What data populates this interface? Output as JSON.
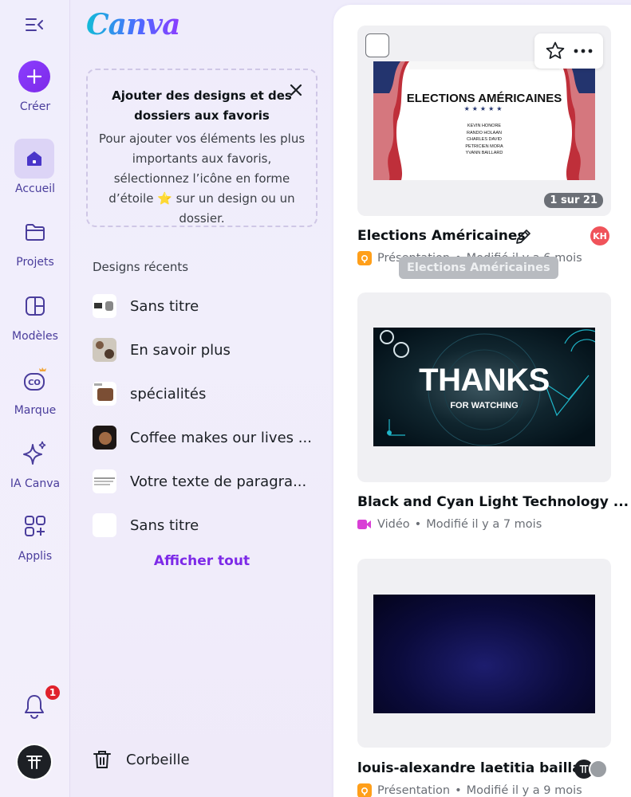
{
  "rail": {
    "create_label": "Créer",
    "items": [
      {
        "label": "Accueil",
        "icon": "home-icon"
      },
      {
        "label": "Projets",
        "icon": "folder-icon"
      },
      {
        "label": "Modèles",
        "icon": "templates-icon"
      },
      {
        "label": "Marque",
        "icon": "brand-icon"
      },
      {
        "label": "IA Canva",
        "icon": "sparkle-icon"
      },
      {
        "label": "Applis",
        "icon": "apps-icon"
      }
    ],
    "notification_count": "1",
    "user_initials": "TT"
  },
  "logo": "Canva",
  "favorites_card": {
    "title": "Ajouter des designs et des dossiers aux favoris",
    "description": "Pour ajouter vos éléments les plus importants aux favoris, sélectionnez l’icône en forme d’étoile ⭐ sur un design ou un dossier."
  },
  "recent": {
    "title": "Designs récents",
    "items": [
      {
        "label": "Sans titre"
      },
      {
        "label": "En savoir plus"
      },
      {
        "label": "spécialités"
      },
      {
        "label": "Coffee makes our lives ..."
      },
      {
        "label": "Votre texte de paragra..."
      },
      {
        "label": "Sans titre"
      }
    ],
    "show_all": "Afficher tout"
  },
  "trash_label": "Corbeille",
  "designs": [
    {
      "title": "Elections Américaines",
      "type": "Présentation",
      "modified": "Modifié il y a 6 mois",
      "pages": "1 sur 21",
      "tooltip": "Elections Américaines",
      "avatar": "KH",
      "thumb_heading": "ELECTIONS AMÉRICAINES",
      "thumb_names": [
        "KEVIN HONORE",
        "RANDO HOLAAN",
        "CHARLES DAVID",
        "PETRICIEN MORA",
        "YVANN BAILLARD"
      ]
    },
    {
      "title": "Black and Cyan Light Technology ...",
      "type": "Vidéo",
      "modified": "Modifié il y a 7 mois",
      "thumb_heading": "THANKS",
      "thumb_sub": "FOR WATCHING"
    },
    {
      "title": "louis-alexandre laetitia bailla...",
      "type": "Présentation",
      "modified": "Modifié il y a 9 mois"
    }
  ],
  "meta_separator": "•",
  "colors": {
    "brand_purple": "#7d2ae8",
    "presentation_orange": "#ff9f1a",
    "video_magenta": "#d93fd6"
  }
}
